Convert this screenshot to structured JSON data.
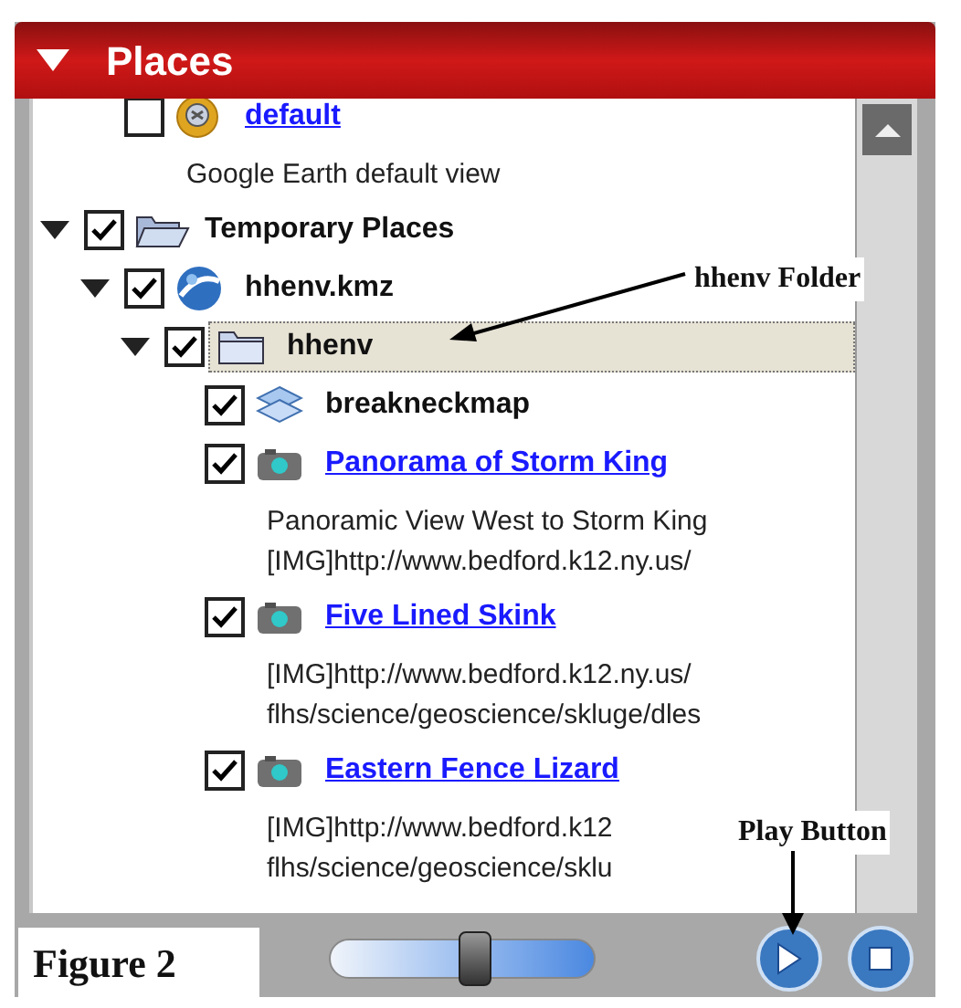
{
  "panel": {
    "title": "Places",
    "expanded": true
  },
  "tree": [
    {
      "children": [
        {
          "kind": "view",
          "title": "default",
          "link": true,
          "checked": false,
          "selected": false,
          "description": [
            "Google Earth default view"
          ]
        }
      ]
    },
    {
      "kind": "folder-open",
      "title": "Temporary Places",
      "link": false,
      "checked": true,
      "expanded": true,
      "selected": false,
      "children": [
        {
          "kind": "earth",
          "title": "hhenv.kmz",
          "link": false,
          "checked": true,
          "expanded": true,
          "selected": false,
          "children": [
            {
              "kind": "folder",
              "title": "hhenv",
              "link": false,
              "checked": true,
              "expanded": true,
              "selected": true,
              "children": [
                {
                  "kind": "overlay",
                  "title": "breakneckmap",
                  "link": false,
                  "checked": true,
                  "selected": false
                },
                {
                  "kind": "photo",
                  "title": "Panorama of Storm King",
                  "link": true,
                  "checked": true,
                  "selected": false,
                  "description": [
                    "Panoramic View West to Storm King",
                    "[IMG]http://www.bedford.k12.ny.us/"
                  ]
                },
                {
                  "kind": "photo",
                  "title": "Five Lined Skink",
                  "link": true,
                  "checked": true,
                  "selected": false,
                  "description": [
                    "[IMG]http://www.bedford.k12.ny.us/",
                    "flhs/science/geoscience/skluge/dles"
                  ]
                },
                {
                  "kind": "photo",
                  "title": "Eastern Fence Lizard",
                  "link": true,
                  "checked": true,
                  "selected": false,
                  "description": [
                    "[IMG]http://www.bedford.k12",
                    "flhs/science/geoscience/sklu"
                  ]
                }
              ]
            }
          ]
        }
      ]
    }
  ],
  "tour": {
    "level": 0.55
  },
  "annotations": [
    "hhenv Folder",
    "Play Button"
  ],
  "caption": "Figure 2"
}
